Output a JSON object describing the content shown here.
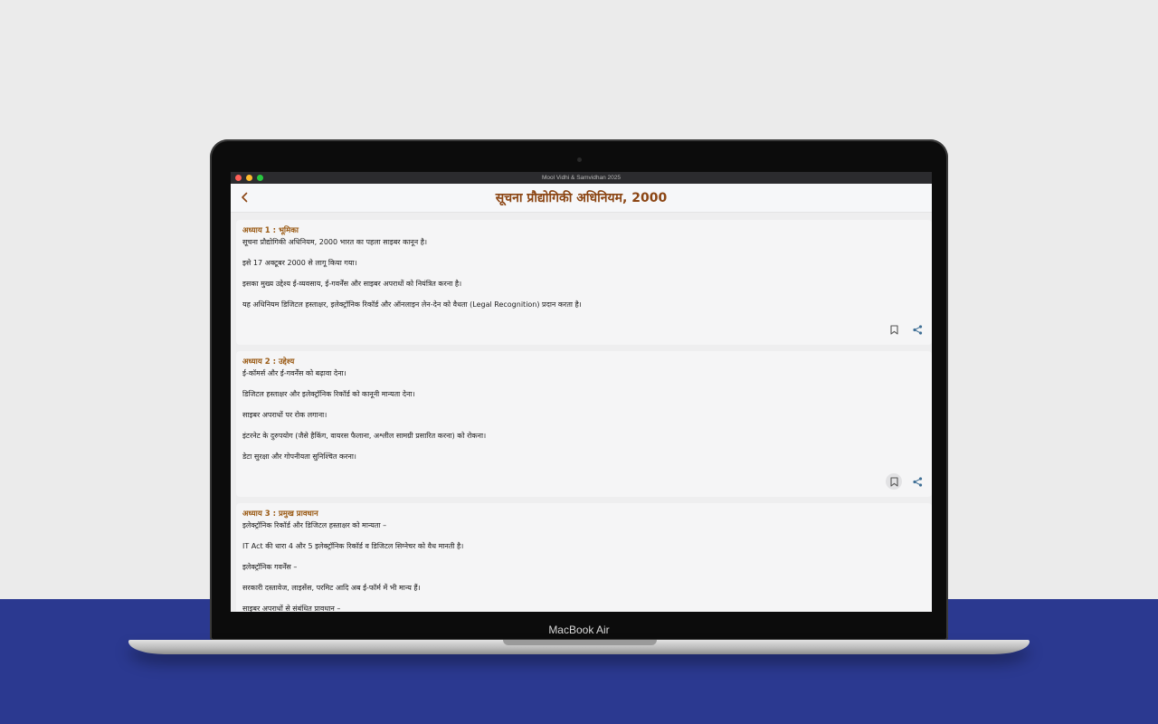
{
  "window": {
    "title": "Mool Vidhi & Samvidhan 2025",
    "traffic_lights": [
      "#ff5f57",
      "#febc2e",
      "#28c840"
    ]
  },
  "device": {
    "label": "MacBook Air"
  },
  "header": {
    "title": "सूचना प्रौद्योगिकी अधिनियम, 2000"
  },
  "colors": {
    "accent": "#8b4513",
    "band": "#2b3990"
  },
  "chapters": [
    {
      "title": "अध्याय 1 : भूमिका",
      "paragraphs": [
        "सूचना प्रौद्योगिकी अधिनियम, 2000 भारत का पहला साइबर कानून है।",
        "इसे 17 अक्टूबर 2000 से लागू किया गया।",
        "इसका मुख्य उद्देश्य ई-व्यवसाय, ई-गवर्नेंस और साइबर अपराधों को नियंत्रित करना है।",
        "यह अधिनियम डिजिटल हस्ताक्षर, इलेक्ट्रॉनिक रिकॉर्ड और ऑनलाइन लेन-देन को वैधता (Legal Recognition) प्रदान करता है।"
      ]
    },
    {
      "title": "अध्याय 2 : उद्देश्य",
      "paragraphs": [
        "ई-कॉमर्स और ई-गवर्नेंस को बढ़ावा देना।",
        "डिजिटल हस्ताक्षर और इलेक्ट्रॉनिक रिकॉर्ड को कानूनी मान्यता देना।",
        "साइबर अपराधों पर रोक लगाना।",
        "इंटरनेट के दुरुपयोग (जैसे हैकिंग, वायरस फैलाना, अश्लील सामग्री प्रसारित करना) को रोकना।",
        "डेटा सुरक्षा और गोपनीयता सुनिश्चित करना।"
      ]
    },
    {
      "title": "अध्याय 3 : प्रमुख प्रावधान",
      "paragraphs": [
        "इलेक्ट्रॉनिक रिकॉर्ड और डिजिटल हस्ताक्षर को मान्यता –",
        "IT Act की धारा 4 और 5 इलेक्ट्रॉनिक रिकॉर्ड व डिजिटल सिग्नेचर को वैध मानती है।",
        "इलेक्ट्रॉनिक गवर्नेंस –",
        "सरकारी दस्तावेज, लाइसेंस, परमिट आदि अब ई-फॉर्म में भी मान्य हैं।",
        "साइबर अपराधों से संबंधित प्रावधान –"
      ]
    }
  ]
}
